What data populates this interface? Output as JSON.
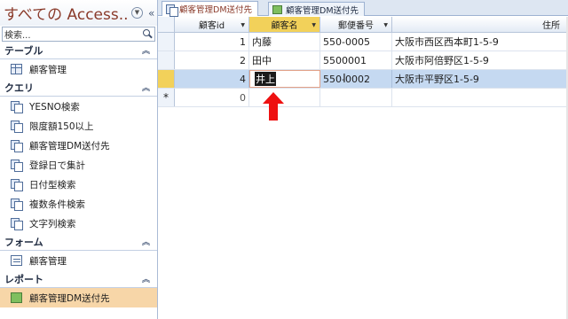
{
  "nav": {
    "title": "すべての Access...",
    "search_text": "検索...",
    "groups": [
      {
        "title": "テーブル",
        "items": [
          {
            "label": "顧客管理",
            "icon": "table-icon"
          }
        ]
      },
      {
        "title": "クエリ",
        "items": [
          {
            "label": "YESNO検索",
            "icon": "query-icon"
          },
          {
            "label": "限度額150以上",
            "icon": "query-icon"
          },
          {
            "label": "顧客管理DM送付先",
            "icon": "query-icon"
          },
          {
            "label": "登録日で集計",
            "icon": "query-icon"
          },
          {
            "label": "日付型検索",
            "icon": "query-icon"
          },
          {
            "label": "複数条件検索",
            "icon": "query-icon"
          },
          {
            "label": "文字列検索",
            "icon": "query-icon"
          }
        ]
      },
      {
        "title": "フォーム",
        "items": [
          {
            "label": "顧客管理",
            "icon": "form-icon"
          }
        ]
      },
      {
        "title": "レポート",
        "items": [
          {
            "label": "顧客管理DM送付先",
            "icon": "report-icon",
            "selected": true
          }
        ]
      }
    ]
  },
  "tabs": [
    {
      "label": "顧客管理DM送付先",
      "active": true
    },
    {
      "label": "顧客管理DM送付先",
      "active": false
    }
  ],
  "table": {
    "columns": [
      "顧客id",
      "顧客名",
      "郵便番号",
      "住所"
    ],
    "rows": [
      {
        "id": "1",
        "name": "内藤",
        "zip": "550-0005",
        "address": "大阪市西区西本町1-5-9"
      },
      {
        "id": "2",
        "name": "田中",
        "zip": "5500001",
        "address": "大阪市阿倍野区1-5-9"
      },
      {
        "id": "4",
        "name": "井上",
        "zip": "550-0002",
        "address": "大阪市平野区1-5-9"
      }
    ],
    "new_row_id": "0",
    "new_row_marker": "*"
  },
  "colors": {
    "accent": "#f2d15a",
    "selected_row": "#c5d9f1",
    "nav_selected": "#f7d6a8",
    "arrow": "#ee1111"
  }
}
